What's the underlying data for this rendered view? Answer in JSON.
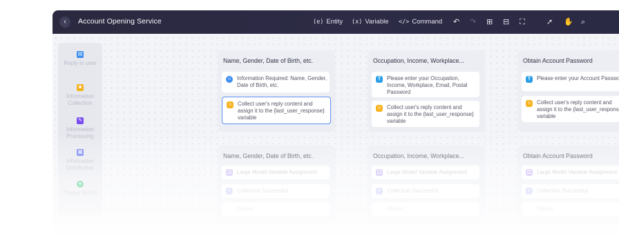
{
  "window": {
    "title": "Account Opening Service"
  },
  "toolbar": {
    "entity": {
      "icon": "(e)",
      "label": "Entity"
    },
    "variable": {
      "icon": "(x)",
      "label": "Variable"
    },
    "command": {
      "icon": "</>",
      "label": "Command"
    },
    "icons": [
      "undo-icon",
      "redo-icon",
      "zoom-in-icon",
      "zoom-out-icon",
      "fit-screen-icon",
      "select-cursor-icon",
      "hand-pan-icon",
      "search-icon"
    ]
  },
  "sidebar": {
    "items": [
      {
        "label": "Reply to user",
        "icon": "chat-icon",
        "color": "#3b8cf0"
      },
      {
        "label": "Information Collection",
        "icon": "folder-icon",
        "color": "#f5b320"
      },
      {
        "label": "Information Processing",
        "icon": "edit-icon",
        "color": "#7b4cf0"
      },
      {
        "label": "Information Distribution",
        "icon": "grid-icon",
        "color": "#6c7bf0"
      },
      {
        "label": "Trigger Action",
        "icon": "circle-icon",
        "color": "#2fbf7c"
      }
    ]
  },
  "nodes_top": [
    {
      "title": "Name, Gender, Date of Birth, etc.",
      "cards": [
        {
          "text": "Information Required: Name, Gender, Date of Birth, etc.",
          "icon": "reply-icon",
          "color": "#3b8cf0"
        },
        {
          "text": "Collect user's reply content and assign it to the {last_user_response} variable",
          "icon": "collect-icon",
          "color": "#f5b320",
          "selected": true
        }
      ]
    },
    {
      "title": "Occupation, Income, Workplace...",
      "cards": [
        {
          "text": "Please enter your Occupation, Income, Workplace, Email, Postal Password",
          "icon": "text-icon",
          "color": "#2b9ee8"
        },
        {
          "text": "Collect user's reply content and assign it to the {last_user_response} variable",
          "icon": "collect-icon",
          "color": "#f5b320"
        }
      ]
    },
    {
      "title": "Obtain Account Password",
      "cards": [
        {
          "text": "Please enter your  Account Password",
          "icon": "text-icon",
          "color": "#2b9ee8"
        },
        {
          "text": "Collect user's reply content and assign it to the {last_user_response} variable",
          "icon": "collect-icon",
          "color": "#f5b320"
        }
      ]
    }
  ],
  "nodes_bottom": [
    {
      "title": "Name, Gender, Date of Birth, etc.",
      "cards": [
        "Large Model Variable Assignment",
        "Collection Successful",
        "Others"
      ]
    },
    {
      "title": "Occupation, Income, Workplace...",
      "cards": [
        "Large Model Variable Assignment",
        "Collection Successful",
        "Others"
      ]
    },
    {
      "title": "Obtain Account Password",
      "cards": [
        "Large Model Variable Assignment",
        "Collection Successful",
        "Others"
      ]
    }
  ]
}
